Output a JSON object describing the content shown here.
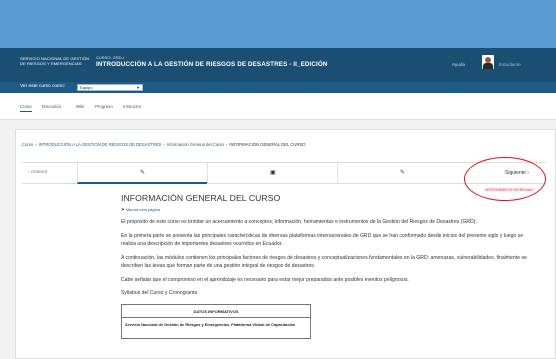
{
  "header": {
    "org_name": "SERVICIO NACIONAL DE GESTIÓN DE RIESGOS Y EMERGENCIAS",
    "course_code": "CURSO: GRD-I",
    "course_title": "INTRODUCCIÓN A LA GESTIÓN DE RIESGOS DE DESASTRES - II_EDICIÓN",
    "help": "Ayuda",
    "user_name": "Estudiante"
  },
  "view_as": {
    "label": "Ver este curso como:",
    "selected": "Equipo"
  },
  "tabs": [
    {
      "label": "Curso"
    },
    {
      "label": "Discusión"
    },
    {
      "label": "Wiki"
    },
    {
      "label": "Progreso"
    },
    {
      "label": "Instructor"
    }
  ],
  "breadcrumb": {
    "items": [
      "Curso",
      "INTRODUCCIÓN A LA GESTIÓN DE RIESGOS DE DESASTRES",
      "Información General del Curso"
    ],
    "current": "INFORMACIÓN GENERAL DEL CURSO"
  },
  "sequence_nav": {
    "previous": "Anterior",
    "next": "Siguiente",
    "items": [
      {
        "icon": "page-icon"
      },
      {
        "icon": "video-icon"
      },
      {
        "icon": "page-icon"
      }
    ]
  },
  "highlight_note": "ANTERIORMENTE ENTREGADO",
  "unit": {
    "title": "INFORMACIÓN GENERAL DEL CURSO",
    "bookmark": "Marcar esta página",
    "paragraphs": [
      "El propósito de este curso es brindar un acercamiento a conceptos, información, herramientas e instrumentos de la Gestión del Riesgos de Desastres (GRD).",
      "En la primera parte se presenta las principales características de diversas plataformas internacionales de GRD que se han conformado desde inicios del presente siglo y luego se realiza una descripción de importantes desastres ocurridos en Ecuador.",
      "A continuación, las módulos contienen los principales factores de riesgos de desastres y conceptualizaciones fundamentales en la GRD: amenazas, vulnerabilidades, finalmente se describen las áreas que forman parte de una gestión integral de riesgos de desastres.",
      "Cabe señalar que el compromiso en el aprendizaje es necesario para estar mejor preparados ante posibles eventos peligrosos."
    ],
    "syllabus": "Syllabus del Curso y Cronograma",
    "table": {
      "header": "DATOS INFORMATIVOS",
      "cell": "Servicio Nacional de Gestión de Riesgos y Emergencias. Plataforma Virtual de Capacitación"
    }
  },
  "colors": {
    "header_bg": "#1a4f73",
    "accent": "#1a5d8f",
    "highlight": "#e0101a",
    "desktop_bg": "#5b9bd5"
  }
}
